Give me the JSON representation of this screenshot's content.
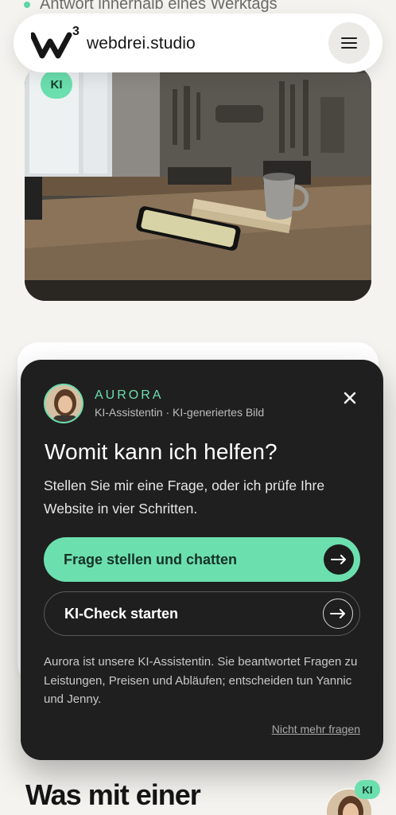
{
  "top_note": {
    "text": "Antwort innerhalb eines Werktags"
  },
  "header": {
    "logo_superscript": "3",
    "brand_name": "webdrei.studio",
    "menu_icon": "hamburger-icon"
  },
  "hero": {
    "badge": "KI"
  },
  "assistant": {
    "name": "AURORA",
    "subtitle": "KI-Assistentin · KI-generiertes Bild",
    "close_icon": "close-icon",
    "title": "Womit kann ich helfen?",
    "intro": "Stellen Sie mir eine Frage, oder ich prüfe Ihre Website in vier Schritten.",
    "primary_cta": "Frage stellen und chatten",
    "secondary_cta": "KI-Check starten",
    "arrow_icon": "arrow-right-icon",
    "footnote": "Aurora ist unsere KI-Assistentin. Sie beantwortet Fragen zu Leistungen, Preisen und Abläufen; entscheiden tun Yannic und Jenny.",
    "dismiss": "Nicht mehr fragen"
  },
  "bottom": {
    "title": "Was mit einer",
    "fab_badge": "KI"
  },
  "colors": {
    "accent": "#6cdfae",
    "popup_bg": "#1f1f1f",
    "page_bg": "#f4f3ef"
  }
}
